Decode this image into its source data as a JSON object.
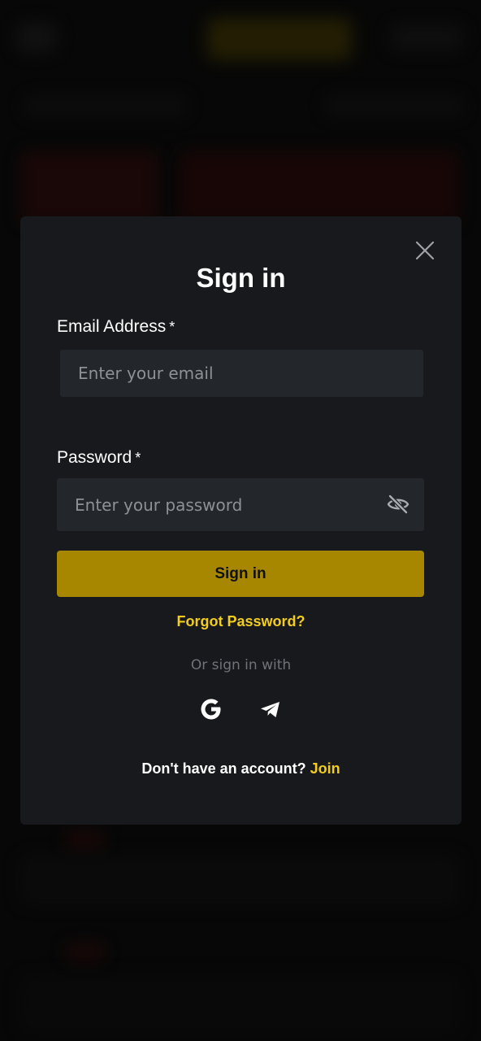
{
  "modal": {
    "title": "Sign in",
    "email": {
      "label": "Email Address",
      "required_mark": "*",
      "placeholder": "Enter your email",
      "value": ""
    },
    "password": {
      "label": "Password",
      "required_mark": "*",
      "placeholder": "Enter your password",
      "value": "",
      "visibility_icon": "eye-off-icon"
    },
    "submit_label": "Sign in",
    "forgot_label": "Forgot Password?",
    "or_label": "Or sign in with",
    "social": [
      {
        "icon": "google-icon"
      },
      {
        "icon": "telegram-icon"
      }
    ],
    "footer": {
      "prompt": "Don't have an account?",
      "link": "Join"
    },
    "close_icon": "close-icon"
  },
  "colors": {
    "overlay": "#050505",
    "modal_bg": "#17191c",
    "input_bg": "#23272b",
    "primary": "#a88700",
    "accent_link": "#f2cd1f",
    "muted_text": "#6f7378"
  }
}
